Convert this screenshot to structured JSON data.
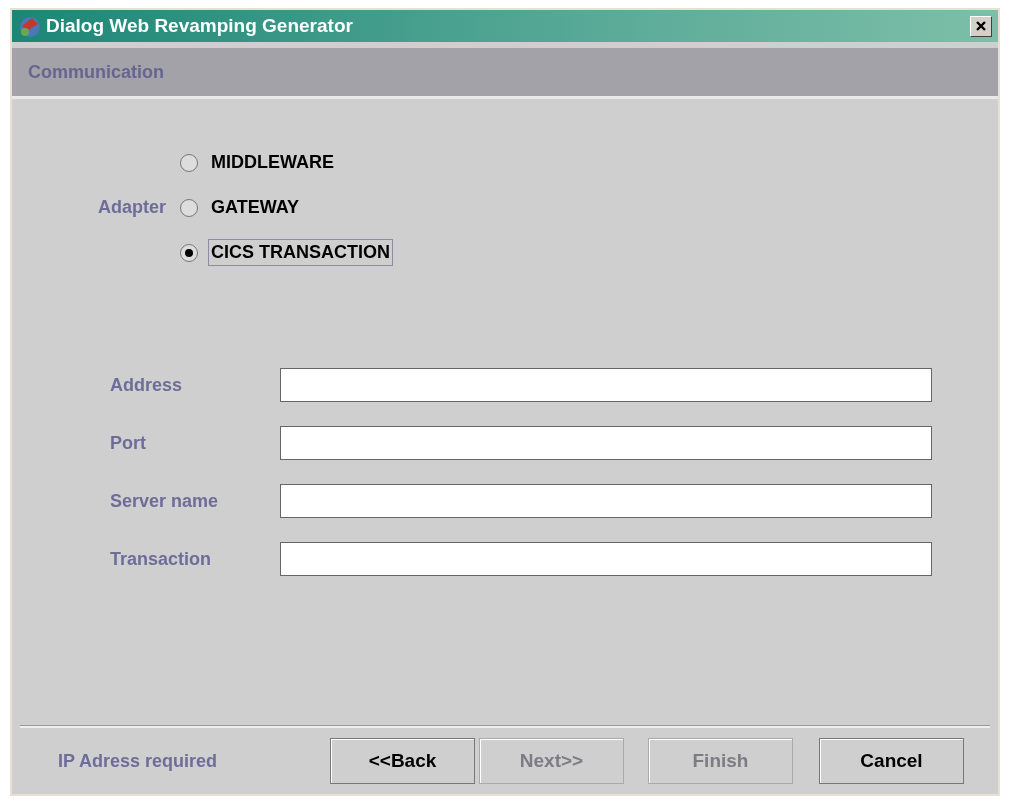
{
  "window": {
    "title": "Dialog Web Revamping Generator"
  },
  "header": {
    "title": "Communication"
  },
  "adapter": {
    "label": "Adapter",
    "options": [
      {
        "label": "MIDDLEWARE",
        "selected": false
      },
      {
        "label": "GATEWAY",
        "selected": false
      },
      {
        "label": "CICS TRANSACTION",
        "selected": true
      }
    ]
  },
  "fields": [
    {
      "label": "Address"
    },
    {
      "label": "Port"
    },
    {
      "label": "Server name"
    },
    {
      "label": "Transaction"
    }
  ],
  "status": "IP Adress required",
  "buttons": [
    {
      "label": "<<Back",
      "disabled": false
    },
    {
      "label": "Next>>",
      "disabled": true
    },
    {
      "label": "Finish",
      "disabled": true
    },
    {
      "label": "Cancel",
      "disabled": false
    }
  ]
}
